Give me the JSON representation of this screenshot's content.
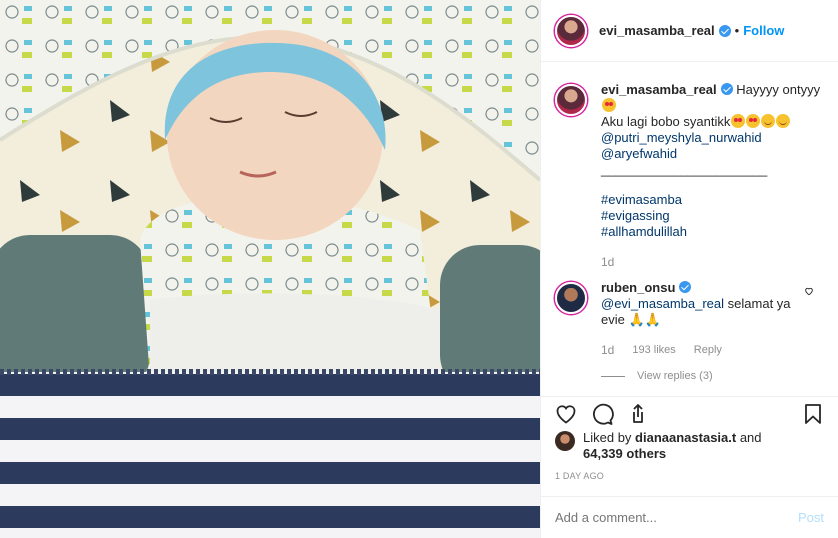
{
  "header": {
    "username": "evi_masamba_real",
    "separator": "•",
    "follow_label": "Follow"
  },
  "caption": {
    "username": "evi_masamba_real",
    "text_line1": "Hayyyy ontyyy",
    "text_line2": "Aku lagi bobo syantikk",
    "mention1": "@putri_meyshyla_nurwahid",
    "mention2": "@aryefwahid",
    "divider": "_______________________",
    "tags": [
      "#evimasamba",
      "#evigassing",
      "#allhamdulillah"
    ],
    "age": "1d"
  },
  "comment": {
    "username": "ruben_onsu",
    "mention": "@evi_masamba_real",
    "text": "selamat ya",
    "text2": "evie",
    "age": "1d",
    "likes": "193 likes",
    "reply_label": "Reply",
    "view_replies": "View replies (3)"
  },
  "likes": {
    "prefix": "Liked by",
    "user": "dianaanastasia.t",
    "and": "and",
    "others": "64,339 others"
  },
  "timestamp": "1 DAY AGO",
  "add_comment": {
    "placeholder": "Add a comment...",
    "post_label": "Post"
  },
  "icons": {
    "like": "heart-icon",
    "comment": "comment-icon",
    "share": "share-icon",
    "save": "bookmark-icon"
  },
  "colors": {
    "link": "#0095f6",
    "hashtag": "#00376b",
    "muted": "#8e8e8e",
    "verified": "#3897f0"
  }
}
